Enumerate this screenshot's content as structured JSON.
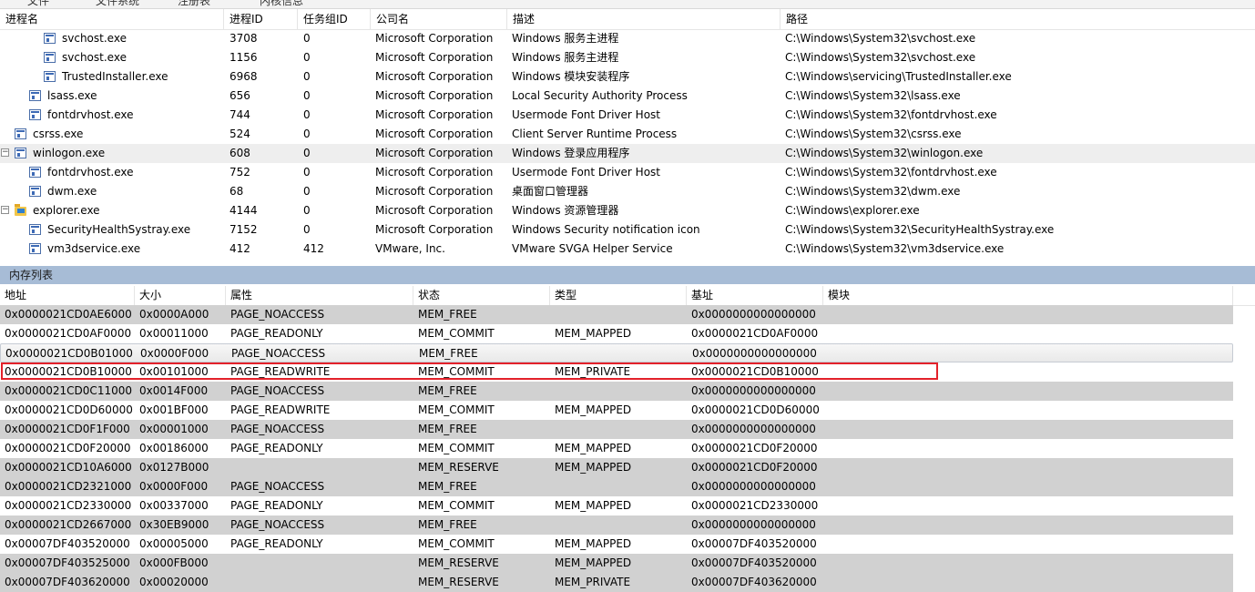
{
  "menu": {
    "items": [
      "文件",
      "文件系统",
      "注册表",
      "内核信息"
    ]
  },
  "process_table": {
    "columns": [
      "进程名",
      "进程ID",
      "任务组ID",
      "公司名",
      "描述",
      "路径"
    ],
    "rows": [
      {
        "name": "svchost.exe",
        "pid": "3708",
        "tgid": "0",
        "company": "Microsoft Corporation",
        "desc": "Windows 服务主进程",
        "path": "C:\\Windows\\System32\\svchost.exe"
      },
      {
        "name": "svchost.exe",
        "pid": "1156",
        "tgid": "0",
        "company": "Microsoft Corporation",
        "desc": "Windows 服务主进程",
        "path": "C:\\Windows\\System32\\svchost.exe"
      },
      {
        "name": "TrustedInstaller.exe",
        "pid": "6968",
        "tgid": "0",
        "company": "Microsoft Corporation",
        "desc": "Windows 模块安装程序",
        "path": "C:\\Windows\\servicing\\TrustedInstaller.exe"
      },
      {
        "name": "lsass.exe",
        "pid": "656",
        "tgid": "0",
        "company": "Microsoft Corporation",
        "desc": "Local Security Authority Process",
        "path": "C:\\Windows\\System32\\lsass.exe"
      },
      {
        "name": "fontdrvhost.exe",
        "pid": "744",
        "tgid": "0",
        "company": "Microsoft Corporation",
        "desc": "Usermode Font Driver Host",
        "path": "C:\\Windows\\System32\\fontdrvhost.exe"
      },
      {
        "name": "csrss.exe",
        "pid": "524",
        "tgid": "0",
        "company": "Microsoft Corporation",
        "desc": "Client Server Runtime Process",
        "path": "C:\\Windows\\System32\\csrss.exe"
      },
      {
        "name": "winlogon.exe",
        "pid": "608",
        "tgid": "0",
        "company": "Microsoft Corporation",
        "desc": "Windows 登录应用程序",
        "path": "C:\\Windows\\System32\\winlogon.exe"
      },
      {
        "name": "fontdrvhost.exe",
        "pid": "752",
        "tgid": "0",
        "company": "Microsoft Corporation",
        "desc": "Usermode Font Driver Host",
        "path": "C:\\Windows\\System32\\fontdrvhost.exe"
      },
      {
        "name": "dwm.exe",
        "pid": "68",
        "tgid": "0",
        "company": "Microsoft Corporation",
        "desc": "桌面窗口管理器",
        "path": "C:\\Windows\\System32\\dwm.exe"
      },
      {
        "name": "explorer.exe",
        "pid": "4144",
        "tgid": "0",
        "company": "Microsoft Corporation",
        "desc": "Windows 资源管理器",
        "path": "C:\\Windows\\explorer.exe"
      },
      {
        "name": "SecurityHealthSystray.exe",
        "pid": "7152",
        "tgid": "0",
        "company": "Microsoft Corporation",
        "desc": "Windows Security notification icon",
        "path": "C:\\Windows\\System32\\SecurityHealthSystray.exe"
      },
      {
        "name": "vm3dservice.exe",
        "pid": "412",
        "tgid": "412",
        "company": "VMware, Inc.",
        "desc": "VMware SVGA Helper Service",
        "path": "C:\\Windows\\System32\\vm3dservice.exe"
      }
    ]
  },
  "memory_section": {
    "title": "内存列表",
    "columns": [
      "地址",
      "大小",
      "属性",
      "状态",
      "类型",
      "基址",
      "模块"
    ],
    "rows": [
      {
        "addr": "0x0000021CD0AE6000",
        "size": "0x0000A000",
        "prot": "PAGE_NOACCESS",
        "state": "MEM_FREE",
        "type": "",
        "base": "0x0000000000000000"
      },
      {
        "addr": "0x0000021CD0AF0000",
        "size": "0x00011000",
        "prot": "PAGE_READONLY",
        "state": "MEM_COMMIT",
        "type": "MEM_MAPPED",
        "base": "0x0000021CD0AF0000"
      },
      {
        "addr": "0x0000021CD0B01000",
        "size": "0x0000F000",
        "prot": "PAGE_NOACCESS",
        "state": "MEM_FREE",
        "type": "",
        "base": "0x0000000000000000"
      },
      {
        "addr": "0x0000021CD0B10000",
        "size": "0x00101000",
        "prot": "PAGE_READWRITE",
        "state": "MEM_COMMIT",
        "type": "MEM_PRIVATE",
        "base": "0x0000021CD0B10000"
      },
      {
        "addr": "0x0000021CD0C11000",
        "size": "0x0014F000",
        "prot": "PAGE_NOACCESS",
        "state": "MEM_FREE",
        "type": "",
        "base": "0x0000000000000000"
      },
      {
        "addr": "0x0000021CD0D60000",
        "size": "0x001BF000",
        "prot": "PAGE_READWRITE",
        "state": "MEM_COMMIT",
        "type": "MEM_MAPPED",
        "base": "0x0000021CD0D60000"
      },
      {
        "addr": "0x0000021CD0F1F000",
        "size": "0x00001000",
        "prot": "PAGE_NOACCESS",
        "state": "MEM_FREE",
        "type": "",
        "base": "0x0000000000000000"
      },
      {
        "addr": "0x0000021CD0F20000",
        "size": "0x00186000",
        "prot": "PAGE_READONLY",
        "state": "MEM_COMMIT",
        "type": "MEM_MAPPED",
        "base": "0x0000021CD0F20000"
      },
      {
        "addr": "0x0000021CD10A6000",
        "size": "0x0127B000",
        "prot": "",
        "state": "MEM_RESERVE",
        "type": "MEM_MAPPED",
        "base": "0x0000021CD0F20000"
      },
      {
        "addr": "0x0000021CD2321000",
        "size": "0x0000F000",
        "prot": "PAGE_NOACCESS",
        "state": "MEM_FREE",
        "type": "",
        "base": "0x0000000000000000"
      },
      {
        "addr": "0x0000021CD2330000",
        "size": "0x00337000",
        "prot": "PAGE_READONLY",
        "state": "MEM_COMMIT",
        "type": "MEM_MAPPED",
        "base": "0x0000021CD2330000"
      },
      {
        "addr": "0x0000021CD2667000",
        "size": "0x30EB9000",
        "prot": "PAGE_NOACCESS",
        "state": "MEM_FREE",
        "type": "",
        "base": "0x0000000000000000"
      },
      {
        "addr": "0x00007DF403520000",
        "size": "0x00005000",
        "prot": "PAGE_READONLY",
        "state": "MEM_COMMIT",
        "type": "MEM_MAPPED",
        "base": "0x00007DF403520000"
      },
      {
        "addr": "0x00007DF403525000",
        "size": "0x000FB000",
        "prot": "",
        "state": "MEM_RESERVE",
        "type": "MEM_MAPPED",
        "base": "0x00007DF403520000"
      },
      {
        "addr": "0x00007DF403620000",
        "size": "0x00020000",
        "prot": "",
        "state": "MEM_RESERVE",
        "type": "MEM_PRIVATE",
        "base": "0x00007DF403620000"
      }
    ]
  },
  "icons": {
    "process": "process-window-icon",
    "folder": "folder-icon",
    "collapse": "collapse-minus-icon"
  },
  "colors": {
    "highlight_border": "#e3212a",
    "section_header": "#a7bcd6",
    "row_gray": "#d1d1d1"
  }
}
